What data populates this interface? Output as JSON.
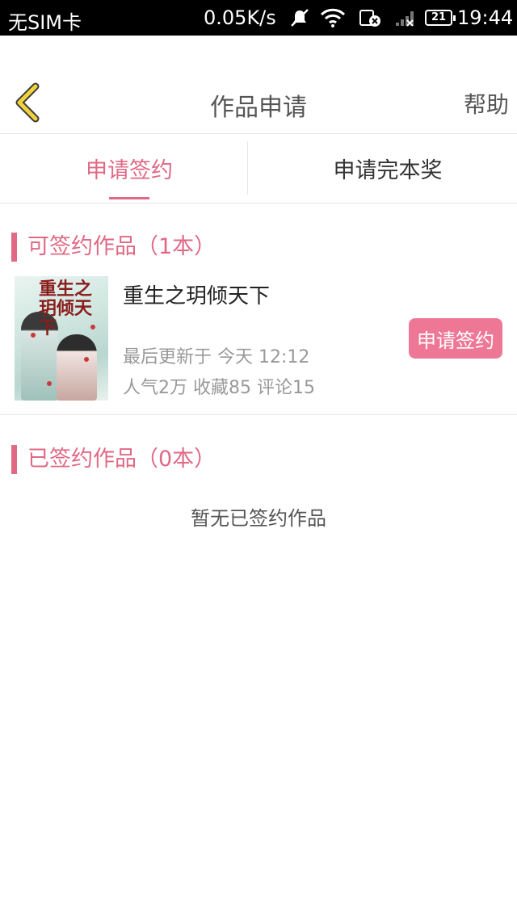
{
  "status_bar": {
    "carrier": "无SIM卡",
    "speed": "0.05K/s",
    "battery": "21",
    "time": "19:44"
  },
  "header": {
    "title": "作品申请",
    "help": "帮助"
  },
  "tabs": [
    {
      "label": "申请签约",
      "active": true
    },
    {
      "label": "申请完本奖",
      "active": false
    }
  ],
  "signable": {
    "heading": "可签约作品（1本）",
    "books": [
      {
        "cover_title": "重生之玥倾天下",
        "name": "重生之玥倾天下",
        "updated": "最后更新于 今天 12:12",
        "stats": "人气2万  收藏85  评论15",
        "action": "申请签约"
      }
    ]
  },
  "signed": {
    "heading": "已签约作品（0本）",
    "empty_text": "暂无已签约作品"
  },
  "colors": {
    "accent": "#e06985",
    "button": "#ee7796"
  }
}
